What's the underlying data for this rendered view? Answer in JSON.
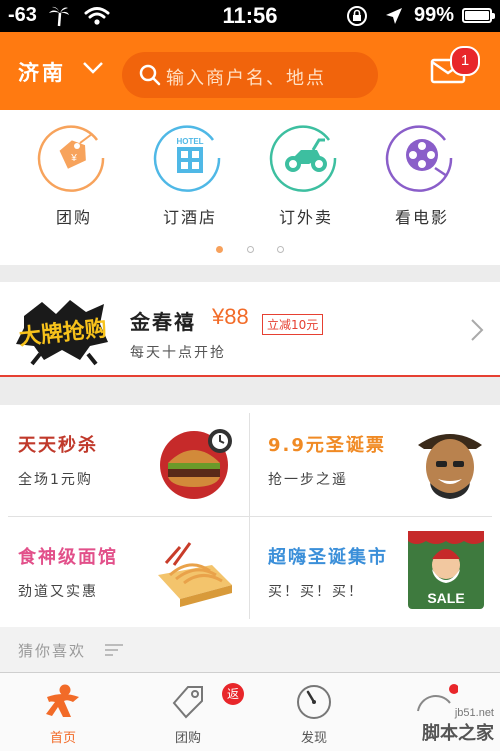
{
  "status_bar": {
    "signal": "-63",
    "time": "11:56",
    "battery": "99%"
  },
  "header": {
    "city": "济南",
    "search_placeholder": "输入商户名、地点",
    "mail_badge": "1"
  },
  "categories": [
    {
      "label": "团购",
      "icon": "tag-icon",
      "color": "#f7a35c"
    },
    {
      "label": "订酒店",
      "icon": "hotel-icon",
      "color": "#4fb8e6"
    },
    {
      "label": "订外卖",
      "icon": "scooter-icon",
      "color": "#3dbfa0"
    },
    {
      "label": "看电影",
      "icon": "film-reel-icon",
      "color": "#8a5ec9"
    }
  ],
  "pager": {
    "total": 3,
    "active": 0
  },
  "promo": {
    "badge_text": "大牌抢购",
    "title": "金春禧",
    "price": "¥88",
    "tag": "立减10元",
    "subtitle": "每天十点开抢"
  },
  "grid": [
    {
      "title": "天天秒杀",
      "subtitle": "全场1元购",
      "color": "#c0392b",
      "image": "burger"
    },
    {
      "title": "9.9元圣诞票",
      "subtitle": "抢一步之遥",
      "color": "#f08a24",
      "image": "actor"
    },
    {
      "title": "食神级面馆",
      "subtitle": "劲道又实惠",
      "color": "#e2508a",
      "image": "noodles"
    },
    {
      "title": "超嗨圣诞集市",
      "subtitle": "买！买！买！",
      "color": "#3b8fd9",
      "image": "santa",
      "image_text": "SALE"
    }
  ],
  "guess": {
    "title": "猜你喜欢"
  },
  "tabbar": {
    "items": [
      {
        "label": "首页",
        "icon": "home-person-icon",
        "active": true
      },
      {
        "label": "团购",
        "icon": "tag-icon",
        "badge": "返"
      },
      {
        "label": "发现",
        "icon": "compass-icon"
      }
    ]
  },
  "watermark": {
    "site": "jb51.net",
    "name": "脚本之家"
  }
}
